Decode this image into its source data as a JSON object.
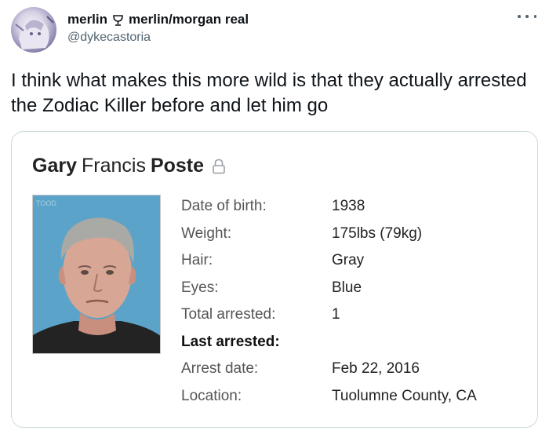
{
  "tweet": {
    "display_name": "merlin",
    "name_icon": "cup-icon",
    "display_name_suffix": "merlin/morgan real",
    "handle": "@dykecastoria",
    "text": "I think what makes this more wild is that they actually arrested the Zodiac Killer before and let him go"
  },
  "card": {
    "name_first": "Gary",
    "name_middle": "Francis",
    "name_last": "Poste",
    "lock_icon": "lock-icon",
    "photo_stamp": "TOOD",
    "facts": [
      {
        "label": "Date of birth:",
        "value": "1938"
      },
      {
        "label": "Weight:",
        "value": "175lbs (79kg)"
      },
      {
        "label": "Hair:",
        "value": "Gray"
      },
      {
        "label": "Eyes:",
        "value": "Blue"
      },
      {
        "label": "Total arrested:",
        "value": "1"
      },
      {
        "label": "Last arrested:",
        "value": ""
      },
      {
        "label": "Arrest date:",
        "value": "Feb 22, 2016"
      },
      {
        "label": "Location:",
        "value": "Tuolumne County, CA"
      }
    ]
  },
  "colors": {
    "secondary_text": "#536471",
    "card_border": "#cfd9de",
    "photo_background": "#5ba3c8"
  }
}
